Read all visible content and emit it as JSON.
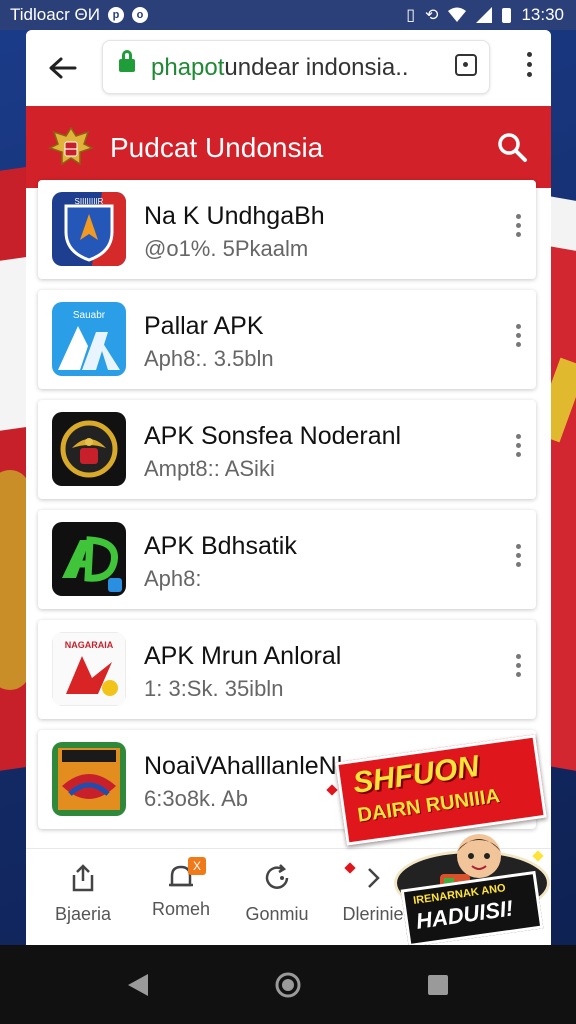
{
  "status_bar": {
    "carrier": "Tidloacr ΘИ",
    "time": "13:30"
  },
  "browser": {
    "url_host": "phapot",
    "url_rest": "undear indonsia.."
  },
  "site": {
    "title": "Pudcat Undonsia"
  },
  "apps": [
    {
      "name": "Na K UndhgaBh",
      "meta": "@o1%. 5Pkaalm",
      "icon": "shield-logo-icon"
    },
    {
      "name": "Pallar APK",
      "meta": "Aph8:. 3.5bln",
      "icon": "ax-logo-icon"
    },
    {
      "name": "APK Sonsfea Noderanl",
      "meta": "Ampt8:: ASiki",
      "icon": "emblem-logo-icon"
    },
    {
      "name": "APK Bdhsatik",
      "meta": "Aph8:",
      "icon": "green-ad-logo-icon"
    },
    {
      "name": "APK Mrun Anloral",
      "meta": "1: 3:Sk. 35ibln",
      "icon": "red-arrow-logo-icon"
    },
    {
      "name": "NoaiVAhalllanleNl",
      "meta": "6:3o8k. Ab",
      "icon": "crest-logo-icon"
    }
  ],
  "icon_labels": {
    "1": "SIIIIIIIIR",
    "2": "Sauabr",
    "5": "NAGARAIA"
  },
  "bottom_nav": [
    {
      "label": "Bjaeria",
      "icon": "share-icon"
    },
    {
      "label": "Romeh",
      "icon": "notification-icon",
      "badge": "X"
    },
    {
      "label": "Gonmiu",
      "icon": "refresh-icon"
    },
    {
      "label": "Dlerinie",
      "icon": "chevron-right-icon"
    }
  ],
  "promo": {
    "line1": "SHFUON",
    "line2": "DAIRN RUNIIIA",
    "line3": "IRENARNAK ANO",
    "line4": "HADUISI!"
  },
  "colors": {
    "header_red": "#d22128",
    "url_green": "#1f8a34",
    "promo_yellow": "#ffe23a"
  }
}
